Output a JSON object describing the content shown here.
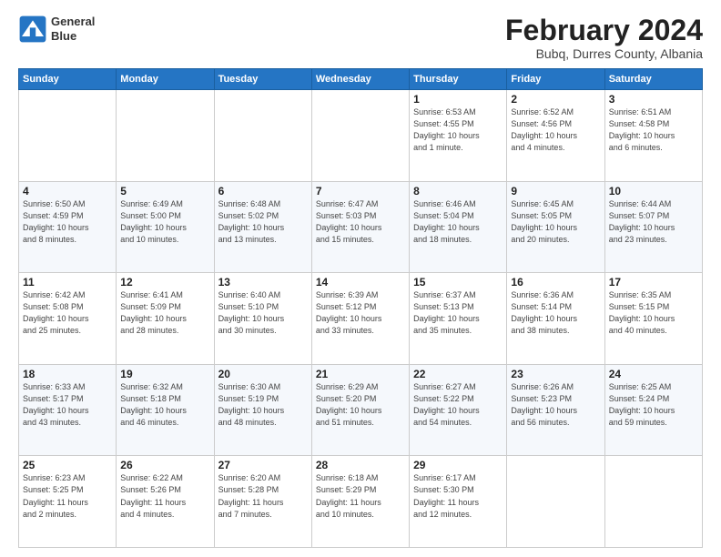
{
  "logo": {
    "line1": "General",
    "line2": "Blue"
  },
  "title": {
    "month_year": "February 2024",
    "location": "Bubq, Durres County, Albania"
  },
  "weekdays": [
    "Sunday",
    "Monday",
    "Tuesday",
    "Wednesday",
    "Thursday",
    "Friday",
    "Saturday"
  ],
  "weeks": [
    [
      {
        "day": "",
        "info": ""
      },
      {
        "day": "",
        "info": ""
      },
      {
        "day": "",
        "info": ""
      },
      {
        "day": "",
        "info": ""
      },
      {
        "day": "1",
        "info": "Sunrise: 6:53 AM\nSunset: 4:55 PM\nDaylight: 10 hours\nand 1 minute."
      },
      {
        "day": "2",
        "info": "Sunrise: 6:52 AM\nSunset: 4:56 PM\nDaylight: 10 hours\nand 4 minutes."
      },
      {
        "day": "3",
        "info": "Sunrise: 6:51 AM\nSunset: 4:58 PM\nDaylight: 10 hours\nand 6 minutes."
      }
    ],
    [
      {
        "day": "4",
        "info": "Sunrise: 6:50 AM\nSunset: 4:59 PM\nDaylight: 10 hours\nand 8 minutes."
      },
      {
        "day": "5",
        "info": "Sunrise: 6:49 AM\nSunset: 5:00 PM\nDaylight: 10 hours\nand 10 minutes."
      },
      {
        "day": "6",
        "info": "Sunrise: 6:48 AM\nSunset: 5:02 PM\nDaylight: 10 hours\nand 13 minutes."
      },
      {
        "day": "7",
        "info": "Sunrise: 6:47 AM\nSunset: 5:03 PM\nDaylight: 10 hours\nand 15 minutes."
      },
      {
        "day": "8",
        "info": "Sunrise: 6:46 AM\nSunset: 5:04 PM\nDaylight: 10 hours\nand 18 minutes."
      },
      {
        "day": "9",
        "info": "Sunrise: 6:45 AM\nSunset: 5:05 PM\nDaylight: 10 hours\nand 20 minutes."
      },
      {
        "day": "10",
        "info": "Sunrise: 6:44 AM\nSunset: 5:07 PM\nDaylight: 10 hours\nand 23 minutes."
      }
    ],
    [
      {
        "day": "11",
        "info": "Sunrise: 6:42 AM\nSunset: 5:08 PM\nDaylight: 10 hours\nand 25 minutes."
      },
      {
        "day": "12",
        "info": "Sunrise: 6:41 AM\nSunset: 5:09 PM\nDaylight: 10 hours\nand 28 minutes."
      },
      {
        "day": "13",
        "info": "Sunrise: 6:40 AM\nSunset: 5:10 PM\nDaylight: 10 hours\nand 30 minutes."
      },
      {
        "day": "14",
        "info": "Sunrise: 6:39 AM\nSunset: 5:12 PM\nDaylight: 10 hours\nand 33 minutes."
      },
      {
        "day": "15",
        "info": "Sunrise: 6:37 AM\nSunset: 5:13 PM\nDaylight: 10 hours\nand 35 minutes."
      },
      {
        "day": "16",
        "info": "Sunrise: 6:36 AM\nSunset: 5:14 PM\nDaylight: 10 hours\nand 38 minutes."
      },
      {
        "day": "17",
        "info": "Sunrise: 6:35 AM\nSunset: 5:15 PM\nDaylight: 10 hours\nand 40 minutes."
      }
    ],
    [
      {
        "day": "18",
        "info": "Sunrise: 6:33 AM\nSunset: 5:17 PM\nDaylight: 10 hours\nand 43 minutes."
      },
      {
        "day": "19",
        "info": "Sunrise: 6:32 AM\nSunset: 5:18 PM\nDaylight: 10 hours\nand 46 minutes."
      },
      {
        "day": "20",
        "info": "Sunrise: 6:30 AM\nSunset: 5:19 PM\nDaylight: 10 hours\nand 48 minutes."
      },
      {
        "day": "21",
        "info": "Sunrise: 6:29 AM\nSunset: 5:20 PM\nDaylight: 10 hours\nand 51 minutes."
      },
      {
        "day": "22",
        "info": "Sunrise: 6:27 AM\nSunset: 5:22 PM\nDaylight: 10 hours\nand 54 minutes."
      },
      {
        "day": "23",
        "info": "Sunrise: 6:26 AM\nSunset: 5:23 PM\nDaylight: 10 hours\nand 56 minutes."
      },
      {
        "day": "24",
        "info": "Sunrise: 6:25 AM\nSunset: 5:24 PM\nDaylight: 10 hours\nand 59 minutes."
      }
    ],
    [
      {
        "day": "25",
        "info": "Sunrise: 6:23 AM\nSunset: 5:25 PM\nDaylight: 11 hours\nand 2 minutes."
      },
      {
        "day": "26",
        "info": "Sunrise: 6:22 AM\nSunset: 5:26 PM\nDaylight: 11 hours\nand 4 minutes."
      },
      {
        "day": "27",
        "info": "Sunrise: 6:20 AM\nSunset: 5:28 PM\nDaylight: 11 hours\nand 7 minutes."
      },
      {
        "day": "28",
        "info": "Sunrise: 6:18 AM\nSunset: 5:29 PM\nDaylight: 11 hours\nand 10 minutes."
      },
      {
        "day": "29",
        "info": "Sunrise: 6:17 AM\nSunset: 5:30 PM\nDaylight: 11 hours\nand 12 minutes."
      },
      {
        "day": "",
        "info": ""
      },
      {
        "day": "",
        "info": ""
      }
    ]
  ]
}
